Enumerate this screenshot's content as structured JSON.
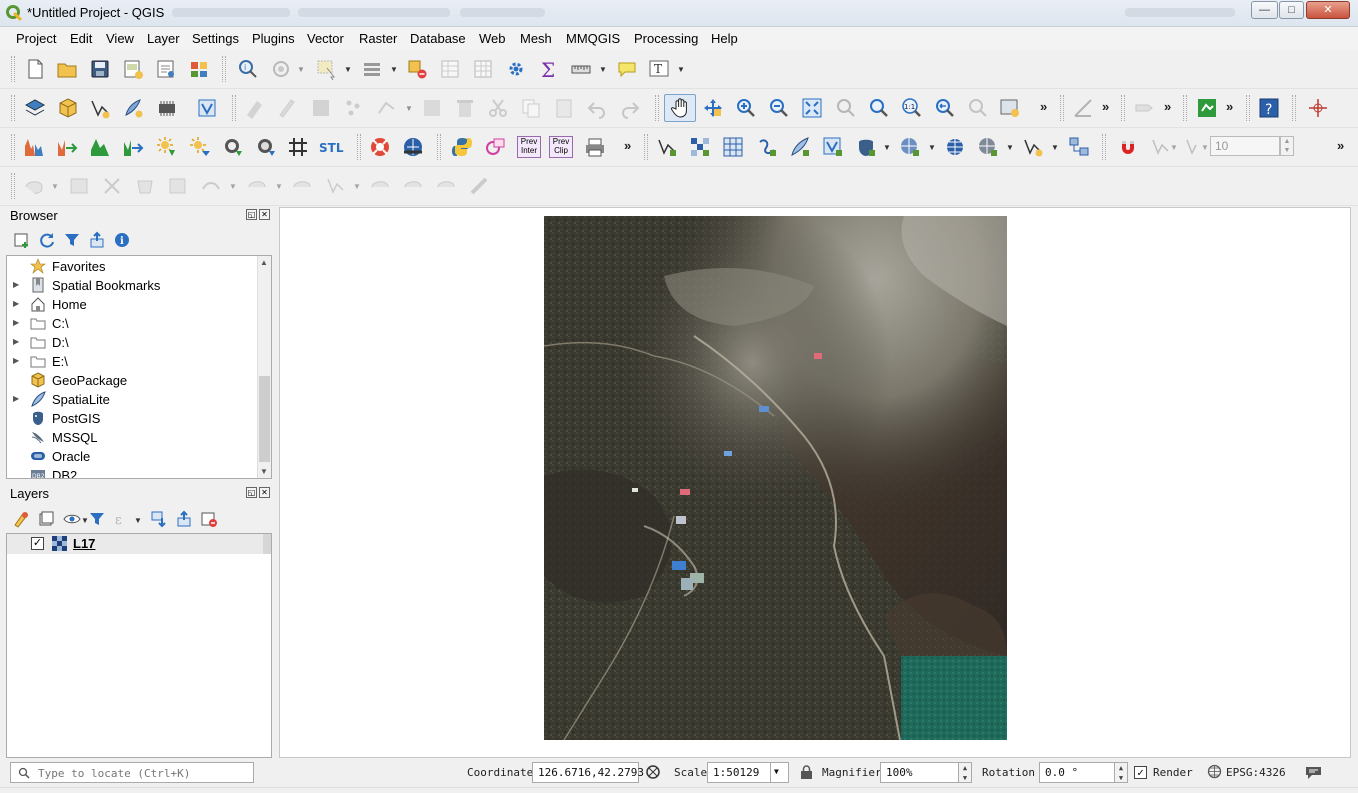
{
  "window": {
    "title": "*Untitled Project - QGIS",
    "buttons": {
      "minimize": "—",
      "maximize": "□",
      "close": "✕"
    }
  },
  "menu": [
    "Project",
    "Edit",
    "View",
    "Layer",
    "Settings",
    "Plugins",
    "Vector",
    "Raster",
    "Database",
    "Web",
    "Mesh",
    "MMQGIS",
    "Processing",
    "Help"
  ],
  "toolbar": {
    "more_glyph": "»",
    "stl_label": "STL",
    "prev_inter_label": [
      "Prev",
      "Inter"
    ],
    "prev_clip_label": [
      "Prev",
      "Clip"
    ],
    "t_label": "T",
    "scale_1_1": "1:1",
    "snapping_tolerance_value": "10"
  },
  "browser": {
    "title": "Browser",
    "items": [
      {
        "label": "Favorites",
        "icon": "star-icon",
        "expandable": false
      },
      {
        "label": "Spatial Bookmarks",
        "icon": "bookmark-icon",
        "expandable": true
      },
      {
        "label": "Home",
        "icon": "home-icon",
        "expandable": true
      },
      {
        "label": "C:\\",
        "icon": "folder-icon",
        "expandable": true
      },
      {
        "label": "D:\\",
        "icon": "folder-icon",
        "expandable": true
      },
      {
        "label": "E:\\",
        "icon": "folder-icon",
        "expandable": true
      },
      {
        "label": "GeoPackage",
        "icon": "geopackage-icon",
        "expandable": false
      },
      {
        "label": "SpatiaLite",
        "icon": "spatialite-icon",
        "expandable": true
      },
      {
        "label": "PostGIS",
        "icon": "postgis-icon",
        "expandable": false
      },
      {
        "label": "MSSQL",
        "icon": "mssql-icon",
        "expandable": false
      },
      {
        "label": "Oracle",
        "icon": "oracle-icon",
        "expandable": false
      },
      {
        "label": "DB2",
        "icon": "db2-icon",
        "expandable": false
      }
    ]
  },
  "layers": {
    "title": "Layers",
    "items": [
      {
        "label": "L17",
        "checked": true,
        "icon": "raster-layer-icon"
      }
    ]
  },
  "statusbar": {
    "locator_placeholder": "Type to locate (Ctrl+K)",
    "coordinate_label": "Coordinate",
    "coordinate_value": "126.6716,42.2793",
    "scale_label": "Scale",
    "scale_value": "1:50129",
    "magnifier_label": "Magnifier",
    "magnifier_value": "100%",
    "rotation_label": "Rotation",
    "rotation_value": "0.0 °",
    "render_label": "Render",
    "render_checked": true,
    "crs": "EPSG:4326"
  },
  "colors": {
    "accent_blue": "#2b6fc2",
    "qgis_green": "#589632",
    "raster_dark": "#3b3a30",
    "raster_teal": "#1f6a5a"
  }
}
